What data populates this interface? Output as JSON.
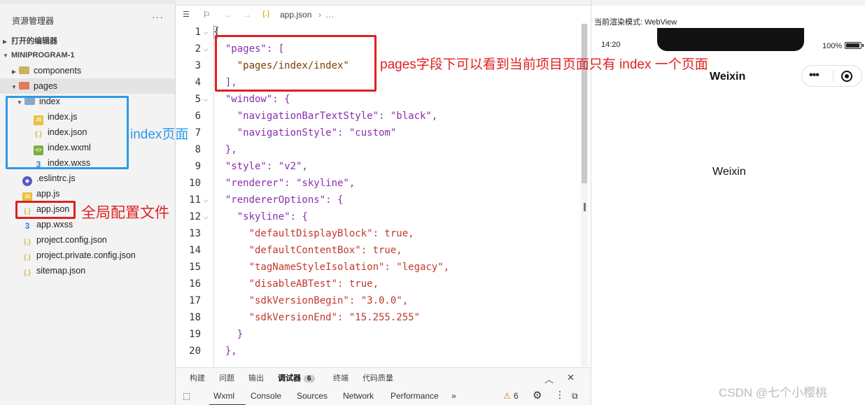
{
  "sidebar": {
    "title": "资源管理器",
    "more": "···",
    "open_editors": "打开的编辑器",
    "project": "MINIPROGRAM-1",
    "items": [
      {
        "label": "components"
      },
      {
        "label": "pages"
      },
      {
        "label": "index"
      },
      {
        "label": "index.js"
      },
      {
        "label": "index.json"
      },
      {
        "label": "index.wxml"
      },
      {
        "label": "index.wxss"
      },
      {
        "label": ".eslintrc.js"
      },
      {
        "label": "app.js"
      },
      {
        "label": "app.json"
      },
      {
        "label": "app.wxss"
      },
      {
        "label": "project.config.json"
      },
      {
        "label": "project.private.config.json"
      },
      {
        "label": "sitemap.json"
      }
    ]
  },
  "editor": {
    "breadcrumb_file": "app.json",
    "breadcrumb_more": "…",
    "line_numbers": [
      "1",
      "2",
      "3",
      "4",
      "5",
      "6",
      "7",
      "8",
      "9",
      "10",
      "11",
      "12",
      "13",
      "14",
      "15",
      "16",
      "17",
      "18",
      "19",
      "20"
    ],
    "code": [
      "{",
      "  \"pages\": [",
      "    \"pages/index/index\"",
      "  ],",
      "  \"window\": {",
      "    \"navigationBarTextStyle\": \"black\",",
      "    \"navigationStyle\": \"custom\"",
      "  },",
      "  \"style\": \"v2\",",
      "  \"renderer\": \"skyline\",",
      "  \"rendererOptions\": {",
      "    \"skyline\": {",
      "      \"defaultDisplayBlock\": true,",
      "      \"defaultContentBox\": true,",
      "      \"tagNameStyleIsolation\": \"legacy\",",
      "      \"disableABTest\": true,",
      "      \"sdkVersionBegin\": \"3.0.0\",",
      "      \"sdkVersionEnd\": \"15.255.255\"",
      "    }",
      "  },"
    ]
  },
  "bottom_panel": {
    "tabs": [
      "构建",
      "问题",
      "输出",
      "调试器",
      "终端",
      "代码质量"
    ],
    "debugger_badge": "6",
    "devtools_tabs": [
      "Wxml",
      "Console",
      "Sources",
      "Network",
      "Performance"
    ],
    "more": "»",
    "warnings": "6"
  },
  "simulator": {
    "render_mode": "当前渲染模式: WebView",
    "time": "14:20",
    "battery": "100%",
    "nav_title": "Weixin",
    "body_text": "Weixin"
  },
  "annotations": {
    "pages_note": "pages字段下可以看到当前项目页面只有 index 一个页面",
    "index_note": "index页面",
    "global_note": "全局配置文件"
  },
  "watermark": "CSDN @七个小樱桃"
}
